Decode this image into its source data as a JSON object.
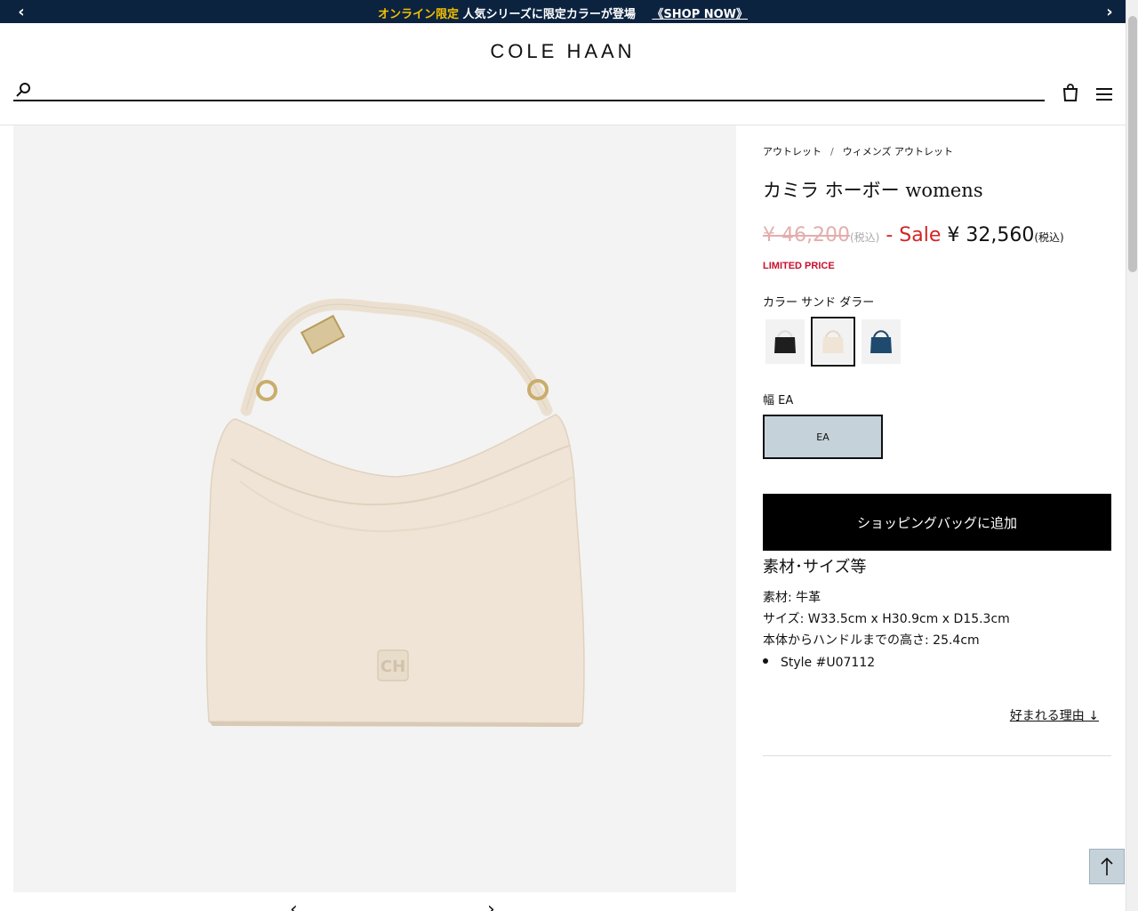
{
  "promo": {
    "highlight": "オンライン限定",
    "message": "人気シリーズに限定カラーが登場",
    "shop_now": "《SHOP NOW》"
  },
  "header": {
    "logo": "COLE HAAN",
    "search_placeholder": ""
  },
  "breadcrumb": {
    "items": [
      "アウトレット",
      "ウィメンズ アウトレット"
    ],
    "separator": "/"
  },
  "product": {
    "title": "カミラ ホーボー womens",
    "original_price": "¥ 46,200",
    "tax_note": "(税込)",
    "sale_label": "- Sale",
    "sale_price": "¥ 32,560",
    "limited": "LIMITED PRICE",
    "color_label": "カラー",
    "color_value": "サンド ダラー",
    "swatches": [
      {
        "name": "black",
        "color": "#1e1e1e"
      },
      {
        "name": "sand-dollar",
        "color": "#efe4d6"
      },
      {
        "name": "navy",
        "color": "#1f4a6e"
      }
    ],
    "selected_swatch": 1,
    "width_label": "幅",
    "width_value": "EA",
    "width_option": "EA",
    "add_to_bag": "ショッピングバッグに追加"
  },
  "specs": {
    "title": "素材･サイズ等",
    "lines": [
      "素材: 牛革",
      "サイズ: W33.5cm x H30.9cm x D15.3cm",
      "本体からハンドルまでの高さ: 25.4cm"
    ],
    "style": "Style #U07112"
  },
  "why_link": "好まれる理由 ↓",
  "colors": {
    "promo_bg": "#0c2340",
    "promo_highlight": "#f5c000",
    "sale_red": "#d32424",
    "limited_red": "#c8102e",
    "width_selected_bg": "#c6d2da",
    "bag_cream": "#efe4d6"
  }
}
